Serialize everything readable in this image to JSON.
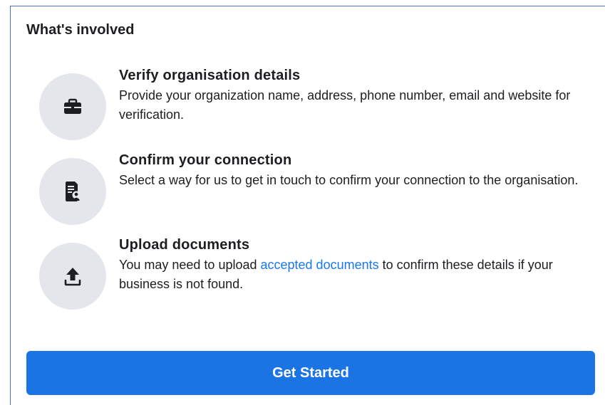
{
  "section": {
    "title": "What's involved"
  },
  "steps": [
    {
      "icon": "briefcase-icon",
      "title": "Verify organisation details",
      "description": "Provide your organization name, address, phone number, email and website for verification."
    },
    {
      "icon": "document-person-icon",
      "title": "Confirm your connection",
      "description": "Select a way for us to get in touch to confirm your connection to the organisation."
    },
    {
      "icon": "upload-icon",
      "title": "Upload documents",
      "description_before": "You may need to upload ",
      "link_text": "accepted documents",
      "description_after": " to confirm these details if your business is not found."
    }
  ],
  "cta": {
    "label": "Get Started"
  },
  "colors": {
    "primary": "#1b74e4",
    "link": "#1877f2",
    "icon_bg": "#e4e6eb",
    "text": "#1c1e21",
    "frame_border": "#4a77b4"
  }
}
